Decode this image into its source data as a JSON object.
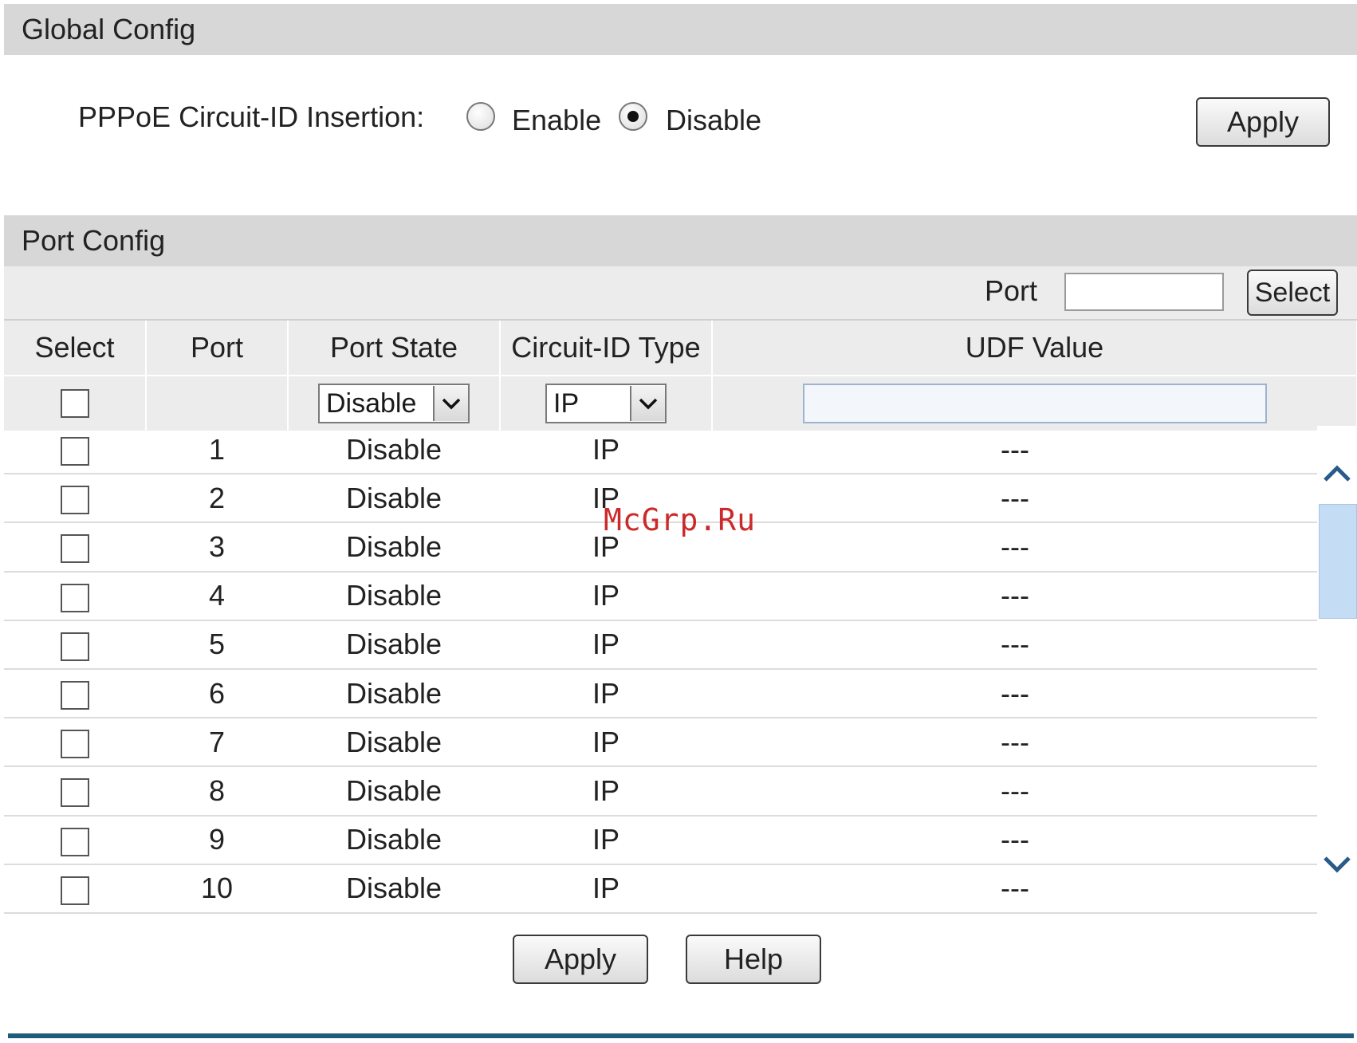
{
  "global_config": {
    "title": "Global Config",
    "pppoe_label": "PPPoE Circuit-ID Insertion:",
    "options": [
      {
        "label": "Enable",
        "checked": false
      },
      {
        "label": "Disable",
        "checked": true
      }
    ],
    "apply_label": "Apply"
  },
  "port_config": {
    "title": "Port Config",
    "port_label": "Port",
    "port_input_value": "",
    "select_button_label": "Select",
    "columns": [
      "Select",
      "Port",
      "Port State",
      "Circuit-ID Type",
      "UDF Value"
    ],
    "controls": {
      "port_state_value": "Disable",
      "circuit_type_value": "IP",
      "udf_value": ""
    },
    "rows": [
      {
        "port": "1",
        "state": "Disable",
        "type": "IP",
        "udf": "---"
      },
      {
        "port": "2",
        "state": "Disable",
        "type": "IP",
        "udf": "---"
      },
      {
        "port": "3",
        "state": "Disable",
        "type": "IP",
        "udf": "---"
      },
      {
        "port": "4",
        "state": "Disable",
        "type": "IP",
        "udf": "---"
      },
      {
        "port": "5",
        "state": "Disable",
        "type": "IP",
        "udf": "---"
      },
      {
        "port": "6",
        "state": "Disable",
        "type": "IP",
        "udf": "---"
      },
      {
        "port": "7",
        "state": "Disable",
        "type": "IP",
        "udf": "---"
      },
      {
        "port": "8",
        "state": "Disable",
        "type": "IP",
        "udf": "---"
      },
      {
        "port": "9",
        "state": "Disable",
        "type": "IP",
        "udf": "---"
      },
      {
        "port": "10",
        "state": "Disable",
        "type": "IP",
        "udf": "---"
      }
    ],
    "apply_label": "Apply",
    "help_label": "Help"
  },
  "watermark": "McGrp.Ru",
  "colors": {
    "section_bar": "#d7d7d7",
    "table_header": "#ececec",
    "scroll_thumb": "#c5dcf5",
    "footer_line": "#1f5c7a",
    "watermark": "#cc2a2a"
  }
}
